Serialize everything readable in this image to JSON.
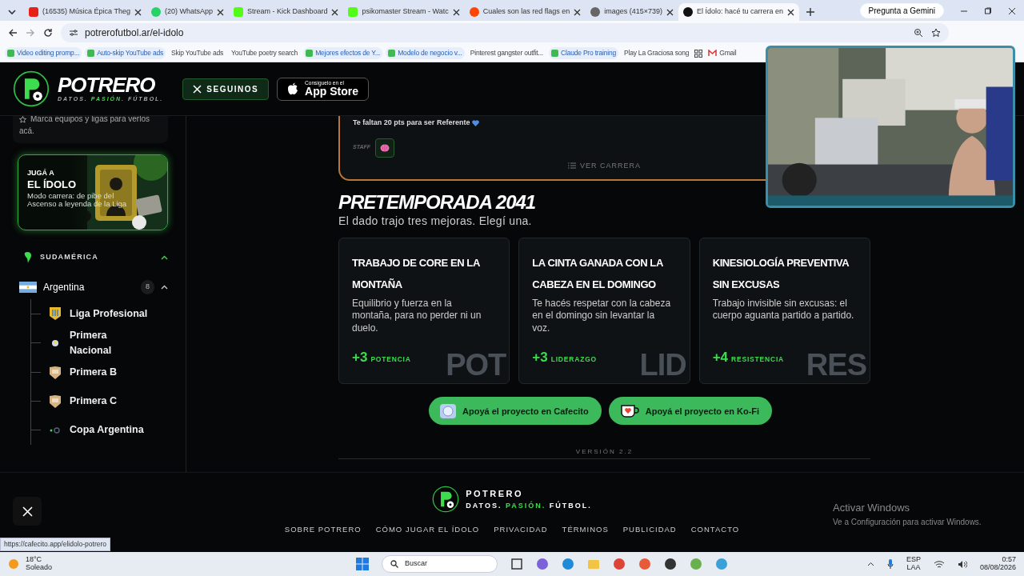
{
  "browser": {
    "tabs": [
      {
        "title": "(16535) Música Épica Theg",
        "selected": false
      },
      {
        "title": "(20) WhatsApp",
        "selected": false
      },
      {
        "title": "Stream - Kick Dashboard",
        "selected": false
      },
      {
        "title": "psikomaster Stream - Watc",
        "selected": false
      },
      {
        "title": "Cuales son las red flags en",
        "selected": false
      },
      {
        "title": "images (415×739)",
        "selected": false
      },
      {
        "title": "El Ídolo: hacé tu carrera en",
        "selected": true
      }
    ],
    "gemini": "Pregunta a Gemini",
    "address": "potrerofutbol.ar/el-idolo",
    "bookmarks": [
      {
        "label": "Video editing promp...",
        "icon": true
      },
      {
        "label": "Auto-skip YouTube ads",
        "icon": true
      },
      {
        "label": "Skip YouTube ads",
        "icon": false
      },
      {
        "label": "YouTube poetry search",
        "icon": false
      },
      {
        "label": "Mejores efectos de Y...",
        "icon": true
      },
      {
        "label": "Modelo de negocio v...",
        "icon": true
      },
      {
        "label": "Pinterest gangster outfit...",
        "icon": false
      },
      {
        "label": "Claude Pro training",
        "icon": true
      },
      {
        "label": "Play La Graciosa song",
        "icon": false
      }
    ],
    "gmail": "Gmail"
  },
  "header": {
    "brand": "POTRERO",
    "tagline": [
      "DATOS.",
      "PASIÓN.",
      "FÚTBOL."
    ],
    "follow": "SEGUINOS",
    "store_small": "Consíguelo en el",
    "store": "App Store"
  },
  "sidebar": {
    "hint": "Marca equipos y ligas para verlos acá.",
    "promo": {
      "kicker": "JUGÁ A",
      "title": "EL ÍDOLO",
      "text": "Modo carrera: de pibe del Ascenso a leyenda de la Liga"
    },
    "region": {
      "name": "SUDAMÉRICA",
      "expanded": true
    },
    "countries": [
      {
        "name": "Argentina",
        "count": "8",
        "expanded": true,
        "children": [
          {
            "name": "Liga Profesional",
            "kind": "liga"
          },
          {
            "name": "Primera Nacional",
            "kind": "nacional"
          },
          {
            "name": "Primera B",
            "kind": "shield"
          },
          {
            "name": "Primera C",
            "kind": "shield"
          },
          {
            "name": "Copa Argentina",
            "kind": "copa"
          }
        ]
      }
    ]
  },
  "career": {
    "progress": "Te faltan 20 pts para ser Referente",
    "staff": "STAFF",
    "view": "VER CARRERA"
  },
  "preseason": {
    "title": "PRETEMPORADA 2041",
    "subtitle": "El dado trajo tres mejoras. Elegí una.",
    "options": [
      {
        "title": "TRABAJO DE CORE EN LA MONTAÑA",
        "text": "Equilibrio y fuerza en la montaña, para no perder ni un duelo.",
        "bonus": "+3",
        "attribute": "POTENCIA",
        "backdrop": "POT"
      },
      {
        "title": "LA CINTA GANADA CON LA CABEZA EN EL DOMINGO",
        "text": "Te hacés respetar con la cabeza en el domingo sin levantar la voz.",
        "bonus": "+3",
        "attribute": "LIDERAZGO",
        "backdrop": "LID"
      },
      {
        "title": "KINESIOLOGÍA PREVENTIVA SIN EXCUSAS",
        "text": "Trabajo invisible sin excusas: el cuerpo aguanta partido a partido.",
        "bonus": "+4",
        "attribute": "RESISTENCIA",
        "backdrop": "RES"
      }
    ]
  },
  "support": [
    {
      "label": "Apoyá el proyecto en Cafecito",
      "kind": "cafecito"
    },
    {
      "label": "Apoyá el proyecto en Ko-Fi",
      "kind": "kofi"
    }
  ],
  "version": "VERSIÓN 2.2",
  "footer": {
    "brand": "POTRERO",
    "tagline": [
      "DATOS.",
      "PASIÓN.",
      "FÚTBOL."
    ],
    "links": [
      "SOBRE POTRERO",
      "CÓMO JUGAR EL ÍDOLO",
      "PRIVACIDAD",
      "TÉRMINOS",
      "PUBLICIDAD",
      "CONTACTO"
    ]
  },
  "status_url": "https://cafecito.app/elidolo-potrero",
  "activation": {
    "title": "Activar Windows",
    "text": "Ve a Configuración para activar Windows."
  },
  "taskbar": {
    "temperature": "18°C",
    "weather": "Soleado",
    "search": "Buscar",
    "language": "ESP",
    "layout": "LAA",
    "time": "0:57",
    "date": "08/08/2026"
  }
}
